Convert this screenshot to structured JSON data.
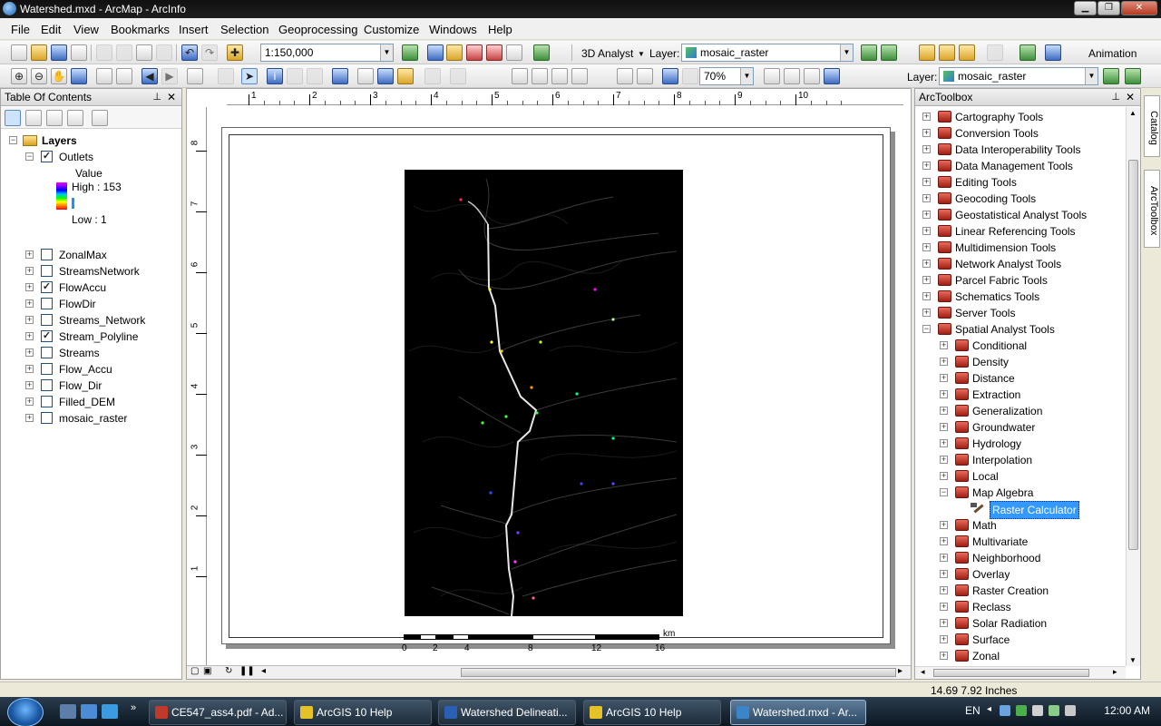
{
  "window": {
    "title": "Watershed.mxd - ArcMap - ArcInfo"
  },
  "menu": [
    "File",
    "Edit",
    "View",
    "Bookmarks",
    "Insert",
    "Selection",
    "Geoprocessing",
    "Customize",
    "Windows",
    "Help"
  ],
  "toolbar1": {
    "scale": "1:150,000",
    "analyst": "3D Analyst",
    "layer_label": "Layer:",
    "layer_value": "mosaic_raster",
    "animation": "Animation"
  },
  "toolbar2": {
    "zoom": "70%",
    "layer_label": "Layer:",
    "layer_value": "mosaic_raster"
  },
  "toc": {
    "title": "Table Of Contents",
    "group": "Layers",
    "outlets": {
      "name": "Outlets",
      "field": "Value",
      "high": "High : 153",
      "low": "Low : 1",
      "checked": true
    },
    "layers": [
      {
        "name": "ZonalMax",
        "checked": false
      },
      {
        "name": "StreamsNetwork",
        "checked": false
      },
      {
        "name": "FlowAccu",
        "checked": true
      },
      {
        "name": "FlowDir",
        "checked": false
      },
      {
        "name": "Streams_Network",
        "checked": false
      },
      {
        "name": "Stream_Polyline",
        "checked": true
      },
      {
        "name": "Streams",
        "checked": false
      },
      {
        "name": "Flow_Accu",
        "checked": false
      },
      {
        "name": "Flow_Dir",
        "checked": false
      },
      {
        "name": "Filled_DEM",
        "checked": false
      },
      {
        "name": "mosaic_raster",
        "checked": false
      }
    ]
  },
  "ruler": {
    "h_ticks": [
      "1",
      "2",
      "3",
      "4",
      "5",
      "6",
      "7",
      "8",
      "9",
      "10"
    ],
    "v_ticks": [
      "8",
      "7",
      "6",
      "5",
      "4",
      "3",
      "2",
      "1"
    ]
  },
  "scalebar": {
    "labels": [
      "0",
      "2",
      "4",
      "8",
      "12",
      "16"
    ],
    "unit": "km"
  },
  "toolbox": {
    "title": "ArcToolbox",
    "items": [
      {
        "label": "Cartography Tools",
        "level": 0,
        "expanded": false
      },
      {
        "label": "Conversion Tools",
        "level": 0,
        "expanded": false
      },
      {
        "label": "Data Interoperability Tools",
        "level": 0,
        "expanded": false
      },
      {
        "label": "Data Management Tools",
        "level": 0,
        "expanded": false
      },
      {
        "label": "Editing Tools",
        "level": 0,
        "expanded": false
      },
      {
        "label": "Geocoding Tools",
        "level": 0,
        "expanded": false
      },
      {
        "label": "Geostatistical Analyst Tools",
        "level": 0,
        "expanded": false
      },
      {
        "label": "Linear Referencing Tools",
        "level": 0,
        "expanded": false
      },
      {
        "label": "Multidimension Tools",
        "level": 0,
        "expanded": false
      },
      {
        "label": "Network Analyst Tools",
        "level": 0,
        "expanded": false
      },
      {
        "label": "Parcel Fabric Tools",
        "level": 0,
        "expanded": false
      },
      {
        "label": "Schematics Tools",
        "level": 0,
        "expanded": false
      },
      {
        "label": "Server Tools",
        "level": 0,
        "expanded": false
      },
      {
        "label": "Spatial Analyst Tools",
        "level": 0,
        "expanded": true
      },
      {
        "label": "Conditional",
        "level": 1,
        "expanded": false
      },
      {
        "label": "Density",
        "level": 1,
        "expanded": false
      },
      {
        "label": "Distance",
        "level": 1,
        "expanded": false
      },
      {
        "label": "Extraction",
        "level": 1,
        "expanded": false
      },
      {
        "label": "Generalization",
        "level": 1,
        "expanded": false
      },
      {
        "label": "Groundwater",
        "level": 1,
        "expanded": false
      },
      {
        "label": "Hydrology",
        "level": 1,
        "expanded": false
      },
      {
        "label": "Interpolation",
        "level": 1,
        "expanded": false
      },
      {
        "label": "Local",
        "level": 1,
        "expanded": false
      },
      {
        "label": "Map Algebra",
        "level": 1,
        "expanded": true
      },
      {
        "label": "Raster Calculator",
        "level": 2,
        "tool": true,
        "selected": true
      },
      {
        "label": "Math",
        "level": 1,
        "expanded": false
      },
      {
        "label": "Multivariate",
        "level": 1,
        "expanded": false
      },
      {
        "label": "Neighborhood",
        "level": 1,
        "expanded": false
      },
      {
        "label": "Overlay",
        "level": 1,
        "expanded": false
      },
      {
        "label": "Raster Creation",
        "level": 1,
        "expanded": false
      },
      {
        "label": "Reclass",
        "level": 1,
        "expanded": false
      },
      {
        "label": "Solar Radiation",
        "level": 1,
        "expanded": false
      },
      {
        "label": "Surface",
        "level": 1,
        "expanded": false
      },
      {
        "label": "Zonal",
        "level": 1,
        "expanded": false
      }
    ]
  },
  "sidetabs": {
    "catalog": "Catalog",
    "arctoolbox": "ArcToolbox"
  },
  "status": {
    "coords": "14.69  7.92 Inches"
  },
  "taskbar": {
    "items": [
      {
        "label": "CE547_ass4.pdf - Ad...",
        "icon_color": "#c0392b"
      },
      {
        "label": "ArcGIS 10 Help",
        "icon_color": "#e6c229"
      },
      {
        "label": "Watershed Delineati...",
        "icon_color": "#2b5fb3"
      },
      {
        "label": "ArcGIS 10 Help",
        "icon_color": "#e6c229"
      },
      {
        "label": "Watershed.mxd - Ar...",
        "icon_color": "#3a86c8",
        "active": true
      }
    ],
    "lang": "EN",
    "clock": "12:00 AM"
  }
}
